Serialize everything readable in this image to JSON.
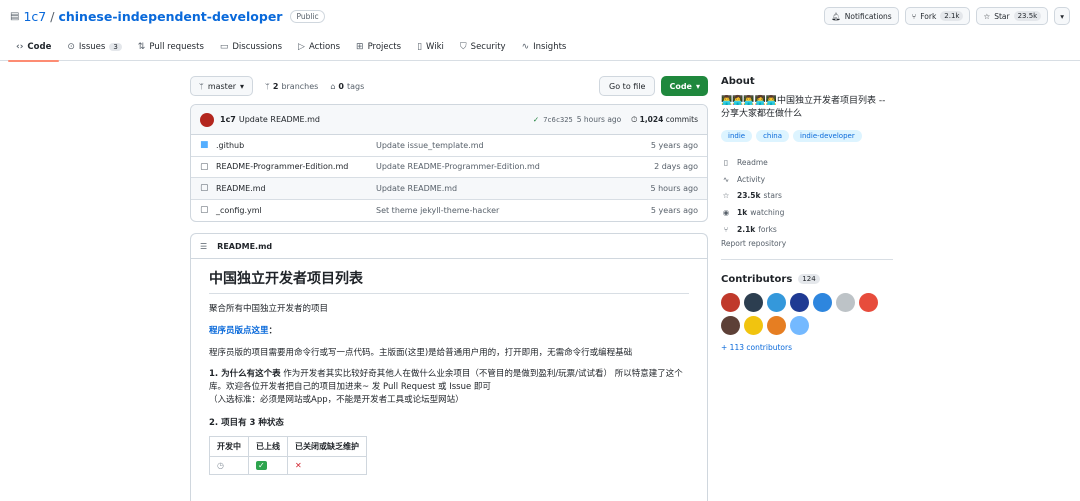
{
  "repo": {
    "owner": "1c7",
    "separator": "/",
    "name": "chinese-independent-developer",
    "visibility": "Public"
  },
  "actions": {
    "notifications": "Notifications",
    "fork_label": "Fork",
    "fork_count": "2.1k",
    "star_label": "Star",
    "star_count": "23.5k"
  },
  "tabs": [
    {
      "label": "Code"
    },
    {
      "label": "Issues",
      "count": "3"
    },
    {
      "label": "Pull requests"
    },
    {
      "label": "Discussions"
    },
    {
      "label": "Actions"
    },
    {
      "label": "Projects"
    },
    {
      "label": "Wiki"
    },
    {
      "label": "Security"
    },
    {
      "label": "Insights"
    }
  ],
  "file_nav": {
    "branch": "master",
    "branches_count": "2",
    "branches_label": "branches",
    "tags_count": "0",
    "tags_label": "tags",
    "go_to_file": "Go to file",
    "code": "Code"
  },
  "latest_commit": {
    "author": "1c7",
    "message": "Update README.md",
    "sha": "7c6c325",
    "time": "5 hours ago",
    "commits_count": "1,024",
    "commits_label": "commits"
  },
  "files": [
    {
      "name": ".github",
      "type": "folder",
      "message": "Update issue_template.md",
      "time": "5 years ago"
    },
    {
      "name": "README-Programmer-Edition.md",
      "type": "file",
      "message": "Update README-Programmer-Edition.md",
      "time": "2 days ago"
    },
    {
      "name": "README.md",
      "type": "file",
      "message": "Update README.md",
      "time": "5 hours ago"
    },
    {
      "name": "_config.yml",
      "type": "file",
      "message": "Set theme jekyll-theme-hacker",
      "time": "5 years ago"
    }
  ],
  "readme": {
    "filename": "README.md",
    "title": "中国独立开发者项目列表",
    "intro": "聚合所有中国独立开发者的项目",
    "programmer_link": "程序员版点这里",
    "programmer_colon": "：",
    "programmer_desc": "程序员版的项目需要用命令行或写一点代码。主版面(这里)是给普通用户用的，打开即用，无需命令行或编程基础",
    "why_bold": "1. 为什么有这个表",
    "why_text": " 作为开发者其实比较好奇其他人在做什么业余项目（不管目的是做到盈利/玩票/试试看） 所以特意建了这个库。欢迎各位开发者把自己的项目加进来~ 发 Pull Request 或 Issue 即可",
    "criteria": "（入选标准：必须是网站或App，不能是开发者工具或论坛型网站）",
    "states_heading": "2. 项目有 3 种状态",
    "table_headers": [
      "开发中",
      "已上线",
      "已关闭或缺乏维护"
    ]
  },
  "about": {
    "heading": "About",
    "description": "👨‍💻👩‍💻👨‍💻👩‍💻👨‍💻中国独立开发者项目列表 -- 分享大家都在做什么",
    "topics": [
      "indie",
      "china",
      "indie-developer"
    ],
    "readme": "Readme",
    "activity": "Activity",
    "stars_count": "23.5k",
    "stars_label": "stars",
    "watching_count": "1k",
    "watching_label": "watching",
    "forks_count": "2.1k",
    "forks_label": "forks",
    "report": "Report repository"
  },
  "contributors": {
    "heading": "Contributors",
    "count": "124",
    "more": "+ 113 contributors",
    "avatar_colors": [
      "#c0392b",
      "#2c3e50",
      "#3498db",
      "#1f3a93",
      "#2e86de",
      "#bdc3c7",
      "#e74c3c",
      "#5d4037",
      "#f1c40f",
      "#e67e22",
      "#74b9ff"
    ]
  }
}
